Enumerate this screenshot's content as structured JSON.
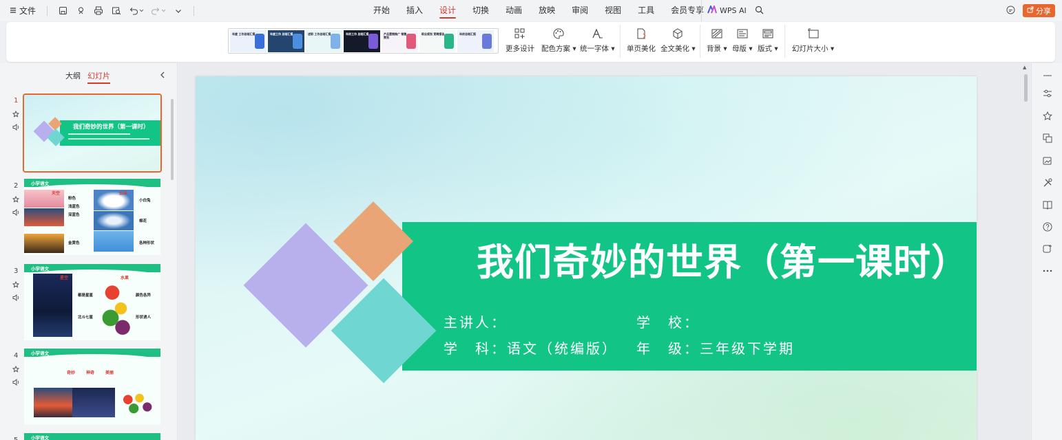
{
  "topbar": {
    "file_label": "文件",
    "tabs": [
      "开始",
      "插入",
      "设计",
      "切换",
      "动画",
      "放映",
      "审阅",
      "视图",
      "工具",
      "会员专享"
    ],
    "active_tab": "设计",
    "wps_ai_label": "WPS AI",
    "share_label": "分享"
  },
  "ribbon": {
    "gallery": [
      {
        "text": "年度 工作总结汇报",
        "bg": "#eaf1fb"
      },
      {
        "text": "年度工作 总结汇报",
        "bg": "#23456e"
      },
      {
        "text": "述职 工作总结汇报",
        "bg": "#e8f6f8"
      },
      {
        "text": "年终工作 总结汇报",
        "bg": "#151a2a"
      },
      {
        "text": "产品营销推广 销售策划",
        "bg": "#f6f4f8"
      },
      {
        "text": "职业规划 竞聘报告",
        "bg": "#f4f9f7"
      },
      {
        "text": "年终总结汇报",
        "bg": "#eef2fb"
      }
    ],
    "buttons": {
      "more_design": "更多设计",
      "color_scheme": "配色方案",
      "unify_font": "统一字体",
      "single_beautify": "单页美化",
      "full_beautify": "全文美化",
      "background": "背景",
      "master": "母版",
      "layout": "版式",
      "slide_size": "幻灯片大小"
    }
  },
  "left_panel": {
    "tabs": [
      "大纲",
      "幻灯片"
    ],
    "active_tab": "幻灯片",
    "slides": [
      {
        "num": "1",
        "title": "我们奇妙的世界（第一课时）"
      },
      {
        "num": "2",
        "header": "小学语文",
        "left_label": "天空",
        "right_label": "云朵",
        "words_left": [
          "粉色",
          "浅蓝色",
          "深蓝色",
          "金黄色"
        ],
        "words_right": [
          "小白兔",
          "棉花",
          "各种形状"
        ]
      },
      {
        "num": "3",
        "header": "小学语文",
        "left_label": "星空",
        "right_label": "水果",
        "words": [
          "都是星星",
          "北斗七星",
          "颜色各异",
          "形状诱人"
        ]
      },
      {
        "num": "4",
        "header": "小学语文",
        "words": [
          "奇妙",
          "神奇",
          "美丽"
        ]
      },
      {
        "num": "5",
        "header": "小学语文"
      }
    ]
  },
  "slide": {
    "title": "我们奇妙的世界（第一课时）",
    "line1_left": "主讲人：",
    "line1_right": "学　校：",
    "line2_left": "学　科：语文（统编版）",
    "line2_right": "年　级：三年级下学期"
  },
  "colors": {
    "accent_red": "#d23a2f",
    "share_orange": "#e8672f",
    "band_green": "#13c487",
    "diamond_purple": "#b8b0ec",
    "diamond_orange": "#eaa577",
    "diamond_teal": "#6fd6d1"
  }
}
